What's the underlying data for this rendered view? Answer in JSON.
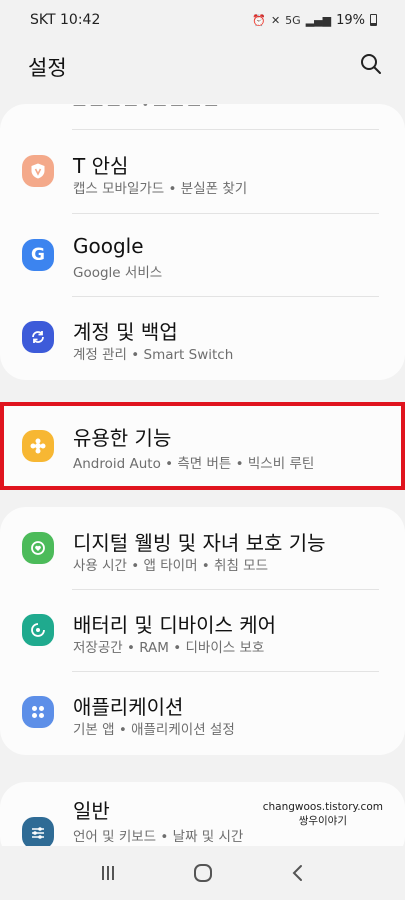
{
  "status_bar": {
    "carrier": "SKT",
    "time": "10:42",
    "signal_label": "5G",
    "battery": "19%"
  },
  "header": {
    "title": "설정"
  },
  "items": [
    {
      "title": "T 안심",
      "subtitle": "캡스 모바일가드  •  분실폰 찾기",
      "icon": "shield-icon",
      "color": "#f4a98a"
    },
    {
      "title": "Google",
      "subtitle": "Google 서비스",
      "icon": "google-icon",
      "color": "#3c84ef"
    },
    {
      "title": "계정 및 백업",
      "subtitle": "계정 관리  •  Smart Switch",
      "icon": "sync-icon",
      "color": "#3d5bd9"
    },
    {
      "title": "유용한 기능",
      "subtitle": "Android Auto  •  측면 버튼  •  빅스비 루틴",
      "icon": "puzzle-icon",
      "color": "#f7b733"
    },
    {
      "title": "디지털 웰빙 및 자녀 보호 기능",
      "subtitle": "사용 시간  •  앱 타이머  •  취침 모드",
      "icon": "wellbeing-icon",
      "color": "#4cbb5a"
    },
    {
      "title": "배터리 및 디바이스 케어",
      "subtitle": "저장공간  •  RAM  •  디바이스 보호",
      "icon": "device-care-icon",
      "color": "#1faa8e"
    },
    {
      "title": "애플리케이션",
      "subtitle": "기본 앱  •  애플리케이션 설정",
      "icon": "apps-icon",
      "color": "#5d8fe8"
    },
    {
      "title": "일반",
      "subtitle": "언어 및 키보드  •  날짜 및 시간",
      "icon": "sliders-icon",
      "color": "#2f6b95"
    }
  ],
  "watermark": {
    "line1": "changwoos.tistory.com",
    "line2": "쌍우이야기"
  },
  "nav": {
    "recents": "recent-apps-icon",
    "home": "home-icon",
    "back": "back-icon"
  }
}
